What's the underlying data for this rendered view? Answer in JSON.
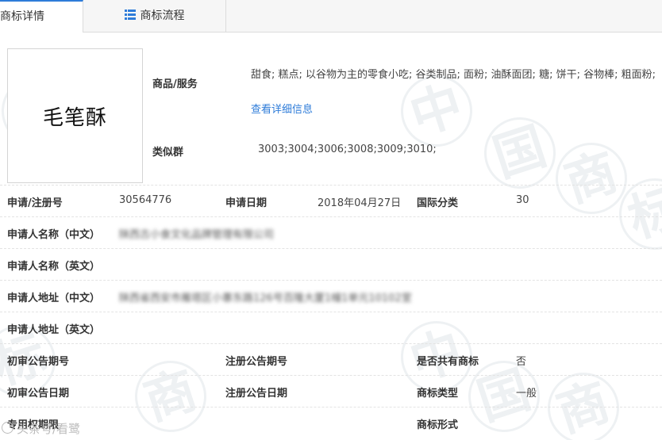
{
  "tabs": [
    {
      "label": "商标详情"
    },
    {
      "label": "商标流程"
    }
  ],
  "watermark": {
    "chars": [
      "中",
      "国",
      "商",
      "标"
    ]
  },
  "trademark": {
    "name": "毛笔酥"
  },
  "goods": {
    "label": "商品/服务",
    "text": "甜食; 糕点; 以谷物为主的零食小吃; 谷类制品; 面粉; 油酥面团; 糖; 饼干; 谷物棒; 粗面粉;",
    "link": "查看详细信息"
  },
  "similar": {
    "label": "类似群",
    "value": "3003;3004;3006;3008;3009;3010;"
  },
  "rows": {
    "reg_no": {
      "label": "申请/注册号",
      "value": "30564776"
    },
    "apply_date": {
      "label": "申请日期",
      "value": "2018年04月27日"
    },
    "intl_class": {
      "label": "国际分类",
      "value": "30"
    },
    "applicant_cn": {
      "label": "申请人名称（中文）",
      "value": "陕西古小食文化品牌管理有限公司"
    },
    "applicant_en": {
      "label": "申请人名称（英文）",
      "value": ""
    },
    "address_cn": {
      "label": "申请人地址（中文）",
      "value": "陕西省西安市雁塔区小寨东路126号百隆大厦1幢1单元10102室"
    },
    "address_en": {
      "label": "申请人地址（英文）",
      "value": ""
    },
    "prelim_no": {
      "label": "初审公告期号",
      "value": ""
    },
    "reg_pub_no": {
      "label": "注册公告期号",
      "value": ""
    },
    "shared": {
      "label": "是否共有商标",
      "value": "否"
    },
    "prelim_date": {
      "label": "初审公告日期",
      "value": ""
    },
    "reg_pub_date": {
      "label": "注册公告日期",
      "value": ""
    },
    "mark_type": {
      "label": "商标类型",
      "value": "一般"
    },
    "exclusive": {
      "label": "专用权期限",
      "value": ""
    },
    "mark_form": {
      "label": "商标形式",
      "value": ""
    }
  },
  "credit": {
    "text": "头条号/看鹭"
  }
}
